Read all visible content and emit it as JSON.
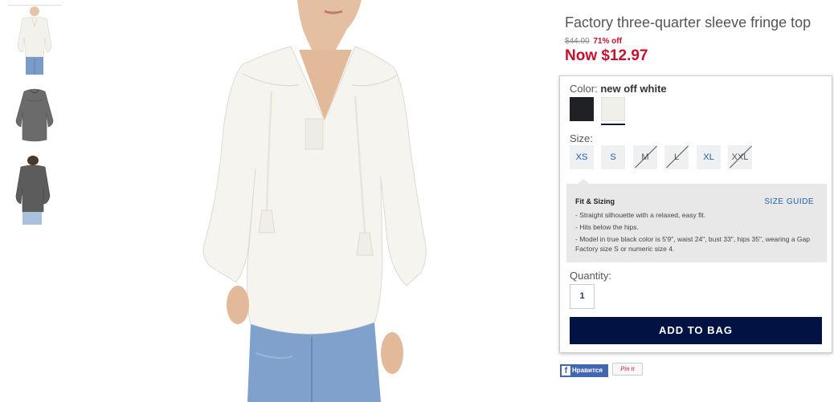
{
  "product": {
    "title": "Factory three-quarter sleeve fringe top",
    "was_price": "$44.00",
    "discount": "71% off",
    "now_price": "Now $12.97"
  },
  "color": {
    "label": "Color:",
    "selected": "new off white",
    "swatches": [
      {
        "name": "black",
        "hex": "#1f2124"
      },
      {
        "name": "new off white",
        "hex": "#f1efe9",
        "selected": true
      }
    ]
  },
  "size": {
    "label": "Size:",
    "options": [
      {
        "label": "XS",
        "available": true
      },
      {
        "label": "S",
        "available": true
      },
      {
        "label": "M",
        "available": false
      },
      {
        "label": "L",
        "available": false
      },
      {
        "label": "XL",
        "available": true
      },
      {
        "label": "XXL",
        "available": false
      }
    ]
  },
  "fit": {
    "title": "Fit & Sizing",
    "guide_link": "SIZE GUIDE",
    "bullets": [
      "- Straight silhouette with a relaxed, easy fit.",
      "- Hits below the hips.",
      "- Model in true black color is 5'9\", waist 24\", bust 33\", hips 35\", wearing a Gap Factory size S or numeric size 4."
    ]
  },
  "quantity": {
    "label": "Quantity:",
    "value": "1"
  },
  "cart": {
    "add_label": "ADD TO BAG"
  },
  "social": {
    "facebook_label": "Нравится",
    "facebook_icon": "f",
    "pinterest_label": "Pin it"
  },
  "colors": {
    "price_red": "#c8102e",
    "link_blue": "#1c5fa5",
    "button_navy": "#021343",
    "fit_bg": "#e8e8e8"
  },
  "thumbnails": [
    "white-top-front",
    "grey-top-flat",
    "grey-top-worn"
  ]
}
